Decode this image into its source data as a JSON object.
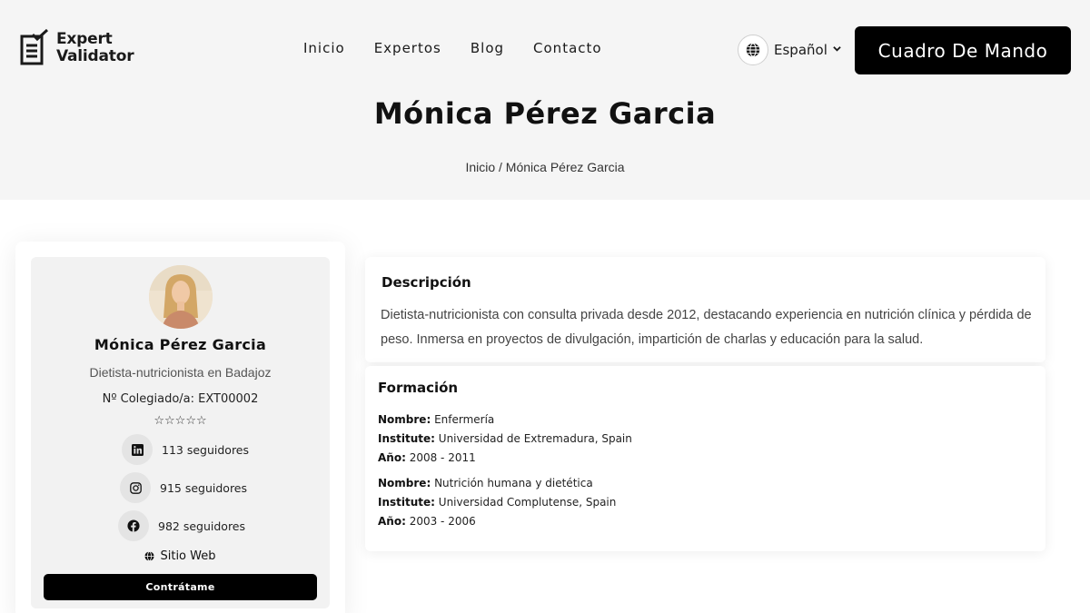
{
  "header": {
    "logo": {
      "line1": "Expert",
      "line2": "Validator"
    },
    "nav": [
      "Inicio",
      "Expertos",
      "Blog",
      "Contacto"
    ],
    "language": "Español",
    "dashboard_label": "Cuadro De Mando"
  },
  "hero": {
    "title": "Mónica Pérez Garcia",
    "breadcrumb": "Inicio / Mónica Pérez Garcia"
  },
  "profile": {
    "name": "Mónica Pérez Garcia",
    "role": "Dietista-nutricionista en Badajoz",
    "registration": "Nº Colegiado/a: EXT00002",
    "rating": 0,
    "rating_max": 5,
    "stars_text": "☆☆☆☆☆",
    "social": [
      {
        "icon": "linkedin-icon",
        "text": "113 seguidores"
      },
      {
        "icon": "instagram-icon",
        "text": "915 seguidores"
      },
      {
        "icon": "facebook-icon",
        "text": "982 seguidores"
      }
    ],
    "website_label": "Sitio Web",
    "hire_label": "Contrátame"
  },
  "description": {
    "title": "Descripción",
    "text": "Dietista-nutricionista con consulta privada desde 2012, destacando experiencia en nutrición clínica y pérdida de peso. Inmersa en proyectos de divulgación, impartición de charlas y educación para la salud."
  },
  "education": {
    "title": "Formación",
    "labels": {
      "name": "Nombre:",
      "institute": "Institute:",
      "year": "Año:"
    },
    "items": [
      {
        "name": "Enfermería",
        "institute": "Universidad de Extremadura, Spain",
        "year": "2008 - 2011"
      },
      {
        "name": "Nutrición humana y dietética",
        "institute": "Universidad Complutense, Spain",
        "year": "2003 - 2006"
      }
    ]
  },
  "colors": {
    "accent": "#000000",
    "hero_bg": "#f5f5f5",
    "card_bg": "#f2f2f2"
  }
}
